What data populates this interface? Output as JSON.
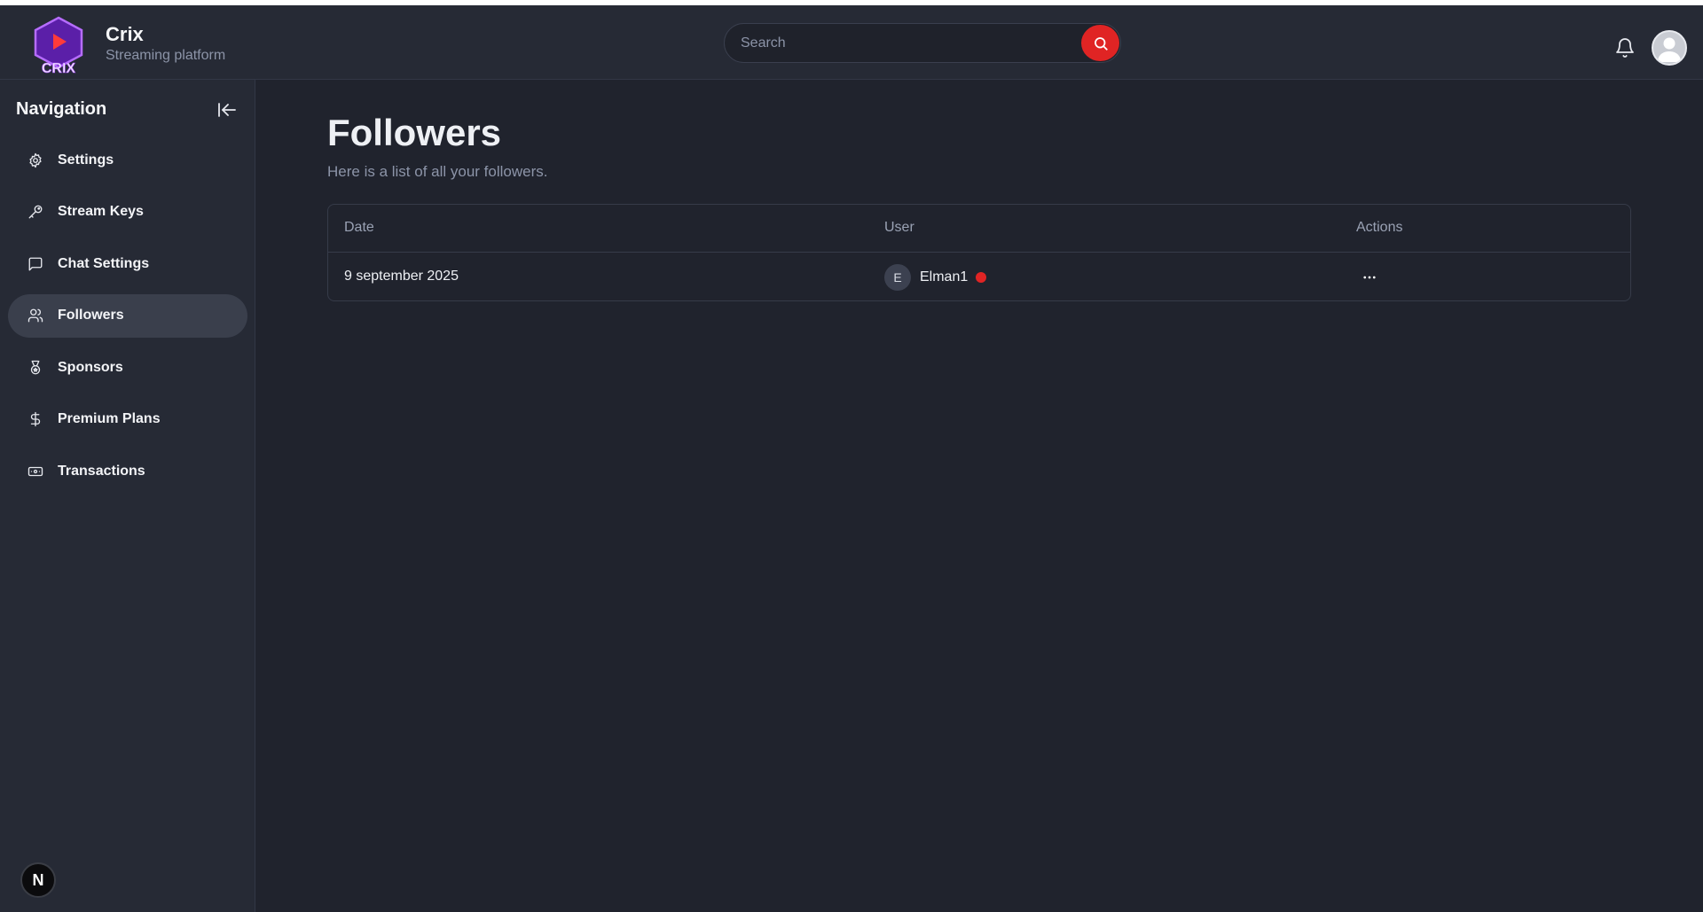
{
  "brand": {
    "name": "Crix",
    "subtitle": "Streaming platform",
    "logo_text": "CRIX",
    "accent": "#e02424",
    "logo_purple": "#9b45e8"
  },
  "search": {
    "placeholder": "Search"
  },
  "sidebar": {
    "title": "Navigation",
    "items": [
      {
        "label": "Settings",
        "icon": "gear-icon",
        "active": false
      },
      {
        "label": "Stream Keys",
        "icon": "key-icon",
        "active": false
      },
      {
        "label": "Chat Settings",
        "icon": "chat-icon",
        "active": false
      },
      {
        "label": "Followers",
        "icon": "users-icon",
        "active": true
      },
      {
        "label": "Sponsors",
        "icon": "award-icon",
        "active": false
      },
      {
        "label": "Premium Plans",
        "icon": "dollar-icon",
        "active": false
      },
      {
        "label": "Transactions",
        "icon": "banknote-icon",
        "active": false
      }
    ],
    "badge": "N"
  },
  "main": {
    "title": "Followers",
    "subtitle": "Here is a list of all your followers.",
    "table": {
      "columns": [
        "Date",
        "User",
        "Actions"
      ],
      "rows": [
        {
          "date": "9 september 2025",
          "user_initial": "E",
          "user_name": "Elman1",
          "status_color": "#e02424"
        }
      ]
    }
  }
}
